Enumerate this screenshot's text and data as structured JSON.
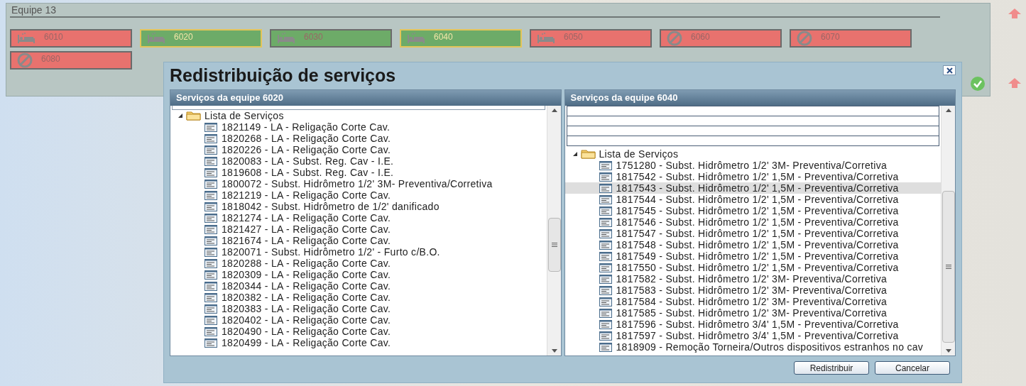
{
  "team_panel": {
    "title": "Equipe 13",
    "teams": [
      {
        "label": "6010",
        "color": "#e8726e",
        "kind": "bed",
        "selected": false
      },
      {
        "label": "6020",
        "color": "#6dab68",
        "kind": "bed",
        "selected": true
      },
      {
        "label": "6030",
        "color": "#6dab68",
        "kind": "bed",
        "selected": false
      },
      {
        "label": "6040",
        "color": "#6dab68",
        "kind": "bed",
        "selected": true
      },
      {
        "label": "6050",
        "color": "#e8726e",
        "kind": "bed",
        "selected": false
      },
      {
        "label": "6060",
        "color": "#e8726e",
        "kind": "blocked",
        "selected": false
      },
      {
        "label": "6070",
        "color": "#e8726e",
        "kind": "blocked",
        "selected": false
      },
      {
        "label": "6080",
        "color": "#e8726e",
        "kind": "blocked",
        "selected": false
      }
    ]
  },
  "dialog": {
    "title": "Redistribuição de serviços",
    "panels": [
      {
        "header": "Serviços da equipe 6020",
        "kind": "source",
        "tree": {
          "label": "Lista de Serviços",
          "expanded": true,
          "children": [
            {
              "label": "1821149 - LA - Religação Corte Cav.",
              "selected": false
            },
            {
              "label": "1820268 - LA - Religação Corte Cav.",
              "selected": false
            },
            {
              "label": "1820226 - LA - Religação Corte Cav.",
              "selected": false
            },
            {
              "label": "1820083 - LA - Subst. Reg. Cav - I.E.",
              "selected": false
            },
            {
              "label": "1819608 - LA - Subst. Reg. Cav - I.E.",
              "selected": false
            },
            {
              "label": "1800072 - Subst. Hidrômetro 1/2' 3M- Preventiva/Corretiva",
              "selected": false
            },
            {
              "label": "1821219 - LA - Religação Corte Cav.",
              "selected": false
            },
            {
              "label": "1818042 - Subst. Hidrômetro de 1/2' danificado",
              "selected": false
            },
            {
              "label": "1821274 - LA - Religação Corte Cav.",
              "selected": false
            },
            {
              "label": "1821427 - LA - Religação Corte Cav.",
              "selected": false
            },
            {
              "label": "1821674 - LA - Religação Corte Cav.",
              "selected": false
            },
            {
              "label": "1820071 - Subst. Hidrômetro 1/2' - Furto c/B.O.",
              "selected": false
            },
            {
              "label": "1820288 - LA - Religação Corte Cav.",
              "selected": false
            },
            {
              "label": "1820309 - LA - Religação Corte Cav.",
              "selected": false
            },
            {
              "label": "1820344 - LA - Religação Corte Cav.",
              "selected": false
            },
            {
              "label": "1820382 - LA - Religação Corte Cav.",
              "selected": false
            },
            {
              "label": "1820383 - LA - Religação Corte Cav.",
              "selected": false
            },
            {
              "label": "1820402 - LA - Religação Corte Cav.",
              "selected": false
            },
            {
              "label": "1820490 - LA - Religação Corte Cav.",
              "selected": false
            },
            {
              "label": "1820499 - LA - Religação Corte Cav.",
              "selected": false
            }
          ]
        }
      },
      {
        "header": "Serviços da equipe 6040",
        "kind": "target",
        "tree": {
          "label": "Lista de Serviços",
          "expanded": true,
          "children": [
            {
              "label": "1751280 - Subst. Hidrômetro 1/2' 3M- Preventiva/Corretiva",
              "selected": false
            },
            {
              "label": "1817542 - Subst. Hidrômetro 1/2' 1,5M - Preventiva/Corretiva",
              "selected": false
            },
            {
              "label": "1817543 - Subst. Hidrômetro 1/2' 1,5M - Preventiva/Corretiva",
              "selected": true
            },
            {
              "label": "1817544 - Subst. Hidrômetro 1/2' 1,5M - Preventiva/Corretiva",
              "selected": false
            },
            {
              "label": "1817545 - Subst. Hidrômetro 1/2' 1,5M - Preventiva/Corretiva",
              "selected": false
            },
            {
              "label": "1817546 - Subst. Hidrômetro 1/2' 1,5M - Preventiva/Corretiva",
              "selected": false
            },
            {
              "label": "1817547 - Subst. Hidrômetro 1/2' 1,5M - Preventiva/Corretiva",
              "selected": false
            },
            {
              "label": "1817548 - Subst. Hidrômetro 1/2' 1,5M - Preventiva/Corretiva",
              "selected": false
            },
            {
              "label": "1817549 - Subst. Hidrômetro 1/2' 1,5M - Preventiva/Corretiva",
              "selected": false
            },
            {
              "label": "1817550 - Subst. Hidrômetro 1/2' 1,5M - Preventiva/Corretiva",
              "selected": false
            },
            {
              "label": "1817582 - Subst. Hidrômetro 1/2' 3M- Preventiva/Corretiva",
              "selected": false
            },
            {
              "label": "1817583 - Subst. Hidrômetro 1/2' 3M- Preventiva/Corretiva",
              "selected": false
            },
            {
              "label": "1817584 - Subst. Hidrômetro 1/2' 3M- Preventiva/Corretiva",
              "selected": false
            },
            {
              "label": "1817585 - Subst. Hidrômetro 1/2' 3M- Preventiva/Corretiva",
              "selected": false
            },
            {
              "label": "1817596 - Subst. Hidrômetro 3/4' 1,5M - Preventiva/Corretiva",
              "selected": false
            },
            {
              "label": "1817597 - Subst. Hidrômetro 3/4' 1,5M - Preventiva/Corretiva",
              "selected": false
            },
            {
              "label": "1818909 - Remoção Torneira/Outros dispositivos estranhos no cav",
              "selected": false
            }
          ]
        }
      }
    ],
    "buttons": [
      "Redistribuir",
      "Cancelar"
    ]
  }
}
